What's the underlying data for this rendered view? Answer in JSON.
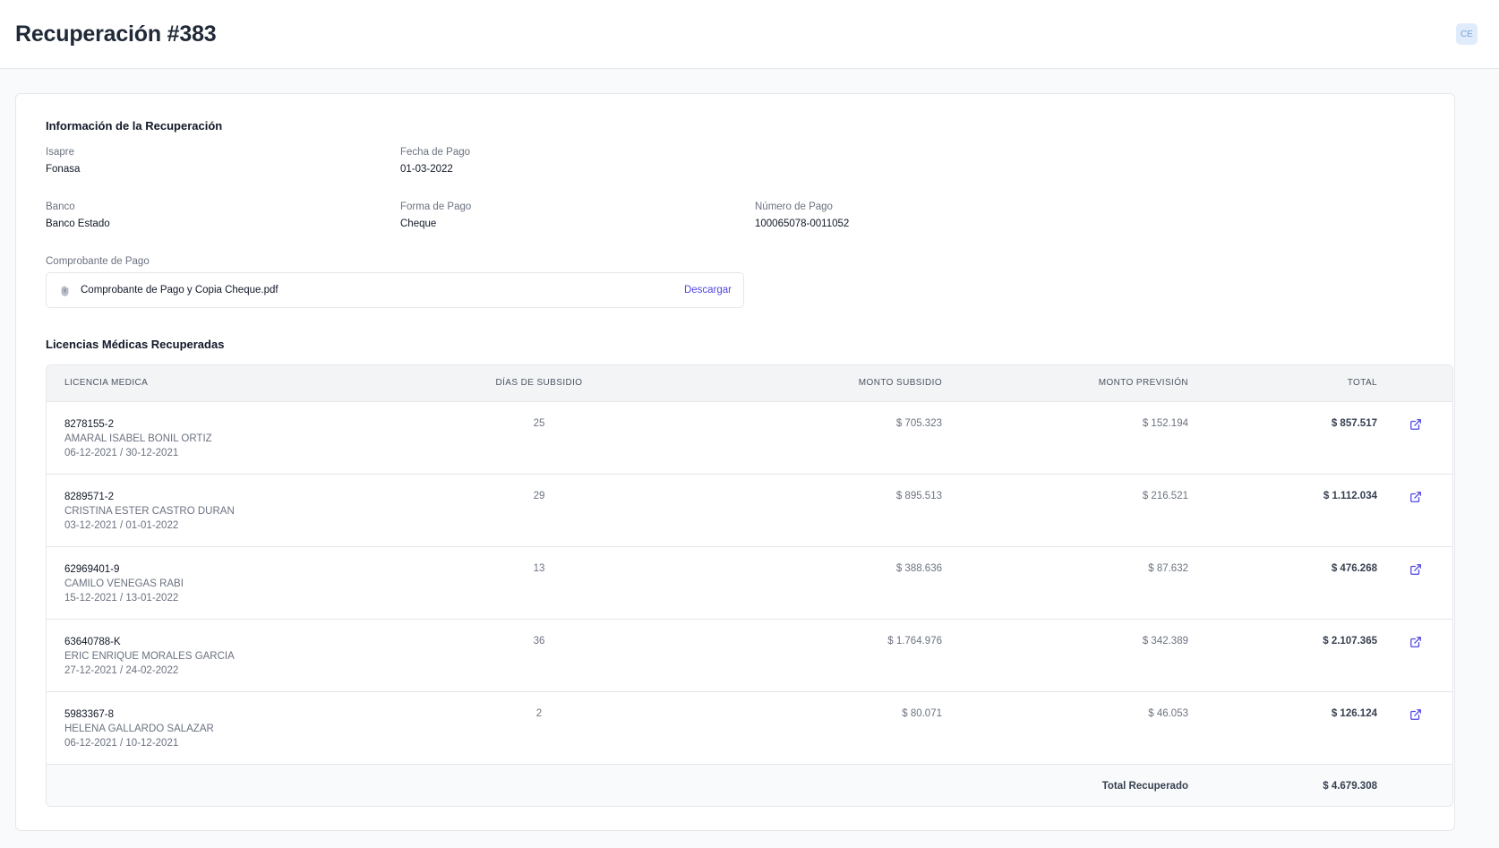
{
  "header": {
    "title": "Recuperación #383",
    "avatar_initials": "CE"
  },
  "info": {
    "section_title": "Información de la Recuperación",
    "isapre": {
      "label": "Isapre",
      "value": "Fonasa"
    },
    "fecha_pago": {
      "label": "Fecha de Pago",
      "value": "01-03-2022"
    },
    "banco": {
      "label": "Banco",
      "value": "Banco Estado"
    },
    "forma_pago": {
      "label": "Forma de Pago",
      "value": "Cheque"
    },
    "numero_pago": {
      "label": "Número de Pago",
      "value": "100065078-0011052"
    },
    "comprobante": {
      "label": "Comprobante de Pago",
      "filename": "Comprobante de Pago y Copia Cheque.pdf",
      "download_label": "Descargar"
    }
  },
  "licencias": {
    "section_title": "Licencias Médicas Recuperadas",
    "columns": {
      "licencia": "LICENCIA MEDICA",
      "dias": "DÍAS DE SUBSIDIO",
      "monto_subsidio": "MONTO SUBSIDIO",
      "monto_prevision": "MONTO PREVISIÓN",
      "total": "TOTAL"
    },
    "rows": [
      {
        "numero": "8278155-2",
        "nombre": "AMARAL ISABEL BONIL ORTIZ",
        "fechas": "06-12-2021 / 30-12-2021",
        "dias": "25",
        "monto_subsidio": "$ 705.323",
        "monto_prevision": "$ 152.194",
        "total": "$ 857.517"
      },
      {
        "numero": "8289571-2",
        "nombre": "CRISTINA ESTER CASTRO DURAN",
        "fechas": "03-12-2021 / 01-01-2022",
        "dias": "29",
        "monto_subsidio": "$ 895.513",
        "monto_prevision": "$ 216.521",
        "total": "$ 1.112.034"
      },
      {
        "numero": "62969401-9",
        "nombre": "CAMILO VENEGAS RABI",
        "fechas": "15-12-2021 / 13-01-2022",
        "dias": "13",
        "monto_subsidio": "$ 388.636",
        "monto_prevision": "$ 87.632",
        "total": "$ 476.268"
      },
      {
        "numero": "63640788-K",
        "nombre": "ERIC ENRIQUE MORALES GARCIA",
        "fechas": "27-12-2021 / 24-02-2022",
        "dias": "36",
        "monto_subsidio": "$ 1.764.976",
        "monto_prevision": "$ 342.389",
        "total": "$ 2.107.365"
      },
      {
        "numero": "5983367-8",
        "nombre": "HELENA GALLARDO SALAZAR",
        "fechas": "06-12-2021 / 10-12-2021",
        "dias": "2",
        "monto_subsidio": "$ 80.071",
        "monto_prevision": "$ 46.053",
        "total": "$ 126.124"
      }
    ],
    "footer": {
      "label": "Total Recuperado",
      "value": "$ 4.679.308"
    }
  },
  "colors": {
    "accent": "#4f46e5",
    "muted_text": "#6b7280",
    "border": "#e5e7eb"
  }
}
